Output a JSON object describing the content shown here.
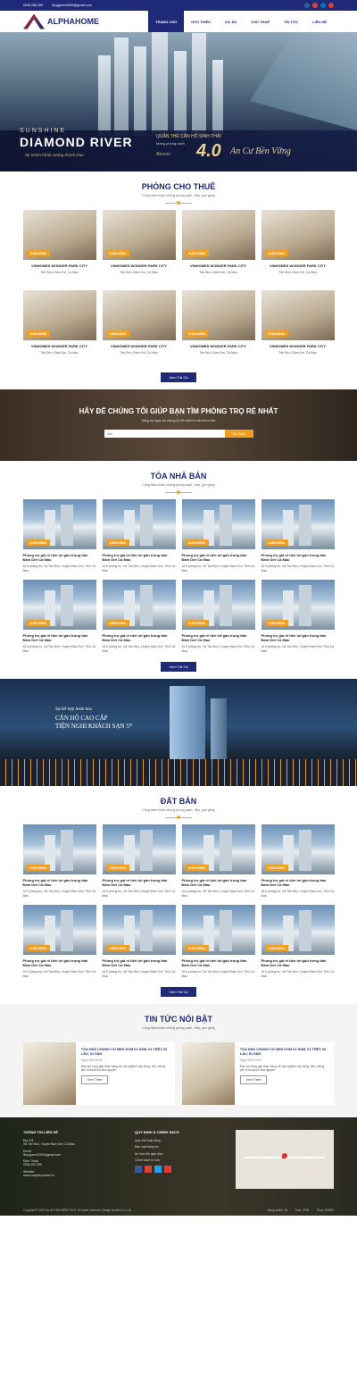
{
  "topbar": {
    "phone": "0938 258 399",
    "email": "lihuygreen2000@gmail.com"
  },
  "logo": {
    "text": "ALPHAHOME"
  },
  "menu": [
    "TRANG CHỦ",
    "GIỚI THIỆU",
    "DỰ ÁN",
    "CHO THUÊ",
    "TIN TỨC",
    "LIÊN HỆ"
  ],
  "hero": {
    "sunshine": "SUNSHINE",
    "name": "DIAMOND RIVER",
    "slogan": "An nhiên thịnh vượng thành khúc",
    "quan": "QUẦN THỂ CĂN HỘ SINH THÁI",
    "mang": "Mang phong cách",
    "resort": "Resort",
    "version": "4.0",
    "ancu": "An Cư Bền Vững"
  },
  "rent": {
    "title": "PHÒNG CHO THUÊ",
    "subtitle": "Cùng tham khảo những phòng sạch , đẹp, gọn gàng",
    "price": "5.000.000đ",
    "cards": [
      {
        "title": "VINHOMES WONDER PARK CITY",
        "loc": "Tân Đức, Đầm Dơi, Cà Mau"
      },
      {
        "title": "VINHOMES WONDER PARK CITY",
        "loc": "Tân Đức, Đầm Dơi, Cà Mau"
      },
      {
        "title": "VINHOMES WONDER PARK CITY",
        "loc": "Tân Đức, Đầm Dơi, Cà Mau"
      },
      {
        "title": "VINHOMES WONDER PARK CITY",
        "loc": "Tân Đức, Đầm Dơi, Cà Mau"
      },
      {
        "title": "VINHOMES WONDER PARK CITY",
        "loc": "Tân Đức, Đầm Dơi, Cà Mau"
      },
      {
        "title": "VINHOMES WONDER PARK CITY",
        "loc": "Tân Đức, Đầm Dơi, Cà Mau"
      },
      {
        "title": "VINHOMES WONDER PARK CITY",
        "loc": "Tân Đức, Đầm Dơi, Cà Mau"
      },
      {
        "title": "VINHOMES WONDER PARK CITY",
        "loc": "Tân Đức, Đầm Dơi, Cà Mau"
      }
    ],
    "button": "Xem Tất Cả"
  },
  "find": {
    "title": "HÃY ĐỂ CHÚNG TÔI GIÚP BẠN TÌM PHÒNG TRỌ RẺ NHẤT",
    "subtitle": "Đăng ký ngay với chúng tôi để nhận tư vấn sớm nhất",
    "placeholder": "Mail",
    "button": "Tìm Kiếm"
  },
  "building": {
    "title": "TÒA NHÀ BÁN",
    "subtitle": "Cùng tham khảo những phòng sạch , đẹp, gọn gàng",
    "price": "5.000.000đ",
    "card_title": "Phòng trọ giá rẻ tiện lợi gần trung tâm Đầm Dơi Cà Mau",
    "card_loc": "16 tỉ phòng trọ. Xã Tân Đức, Huyện Đầm Dơi, Tỉnh Cà Mau",
    "button": "Xem Tất Cả"
  },
  "banner2": {
    "l1": "Sự kết hợp hoàn hảo",
    "l2": "CĂN HỘ CAO CẤP",
    "l3": "TIỆN NGHI KHÁCH SẠN 5*"
  },
  "land": {
    "title": "ĐẤT BÁN",
    "subtitle": "Cùng tham khảo những phòng sạch , đẹp, gọn gàng",
    "price": "5.000.000đ",
    "card_title": "Phòng trọ giá rẻ tiện lợi gần trung tâm Đầm Dơi Cà Mau",
    "card_loc": "16 tỉ phòng trọ. Xã Tân Đức, Huyện Đầm Dơi, Tỉnh Cà Mau",
    "button": "Xem Tất Cả"
  },
  "news": {
    "title": "TIN TỨC NỔI BẬT",
    "subtitle": "Cùng tham khảo những phòng sạch , đẹp, gọn gàng",
    "items": [
      {
        "title": "TÒA NHÀ CHUNG CƯ MINI GỒM 01 HẦM, 01 TRỆT, 06 LẦU, 01 SÂN",
        "date": "Ngày 08/11/2020",
        "text": "Đầu dòi trong giai đoạn hàng nổ của nghành xây dựng, bên những yêu tố thuận lợi khá nguyên",
        "more": "Xem Thêm"
      },
      {
        "title": "TÒA NHÀ CHUNG CƯ MINI GỒM 01 HẦM, 01 TRỆT, 06 LẦU, 01 SÂN",
        "date": "Ngày 08/11/2020",
        "text": "Đầu dòi trong giai đoạn hàng nổ của nghành xây dựng, bên những yêu tố thuận lợi khá nguyên",
        "more": "Xem Thêm"
      }
    ]
  },
  "footer": {
    "contact_title": "THÔNG TIN LIÊN HỆ",
    "addr_label": "Địa Chỉ:",
    "addr": "Xã Tân Đức, Huyện Đầm Dơi, Cà Mau",
    "email_label": "Email:",
    "email": "lihuygreen2000@gmail.com",
    "phone_label": "Điện Thoại:",
    "phone": "0938 152 399",
    "web_label": "Website:",
    "web": "www.companyname.vn",
    "policy_title": "QUY ĐỊNH & CHÍNH SÁCH",
    "policies": [
      "Quy chế hoạt động",
      "Bảo mật thông tin",
      "An toàn khi giao dịch",
      "Chính sách tư vấn"
    ],
    "copyright": "Copyright © 2020 by HUỲNH DIỄM THÚY. All rights reserved. Design by Nina Co.,Ltd",
    "stats": [
      "Đang online: 06",
      "Tuần: 3999",
      "Tổng: 309999"
    ]
  }
}
